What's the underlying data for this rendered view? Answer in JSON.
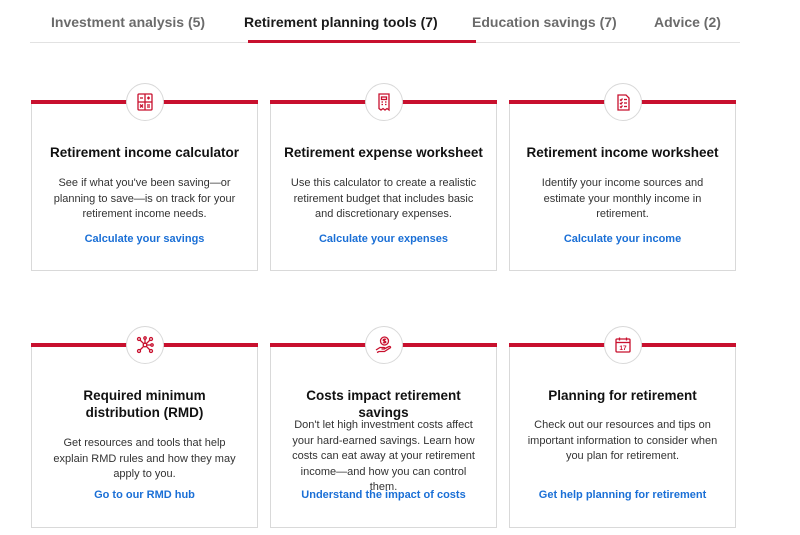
{
  "tabs": [
    {
      "label": "Investment analysis (5)",
      "active": false
    },
    {
      "label": "Retirement planning tools (7)",
      "active": true
    },
    {
      "label": "Education savings (7)",
      "active": false
    },
    {
      "label": "Advice (2)",
      "active": false
    }
  ],
  "accent_color": "#c8102e",
  "link_color": "#1a6fd6",
  "cards": [
    {
      "icon": "calculator-icon",
      "title": "Retirement income calculator",
      "description": "See if what you've been saving—or planning to save—is on track for your retirement income needs.",
      "link": "Calculate your savings"
    },
    {
      "icon": "expense-worksheet-icon",
      "title": "Retirement expense worksheet",
      "description": "Use this calculator to create a realistic retirement budget that includes basic and discretionary expenses.",
      "link": "Calculate your expenses"
    },
    {
      "icon": "checklist-icon",
      "title": "Retirement income worksheet",
      "description": "Identify your income sources and estimate your monthly income in retirement.",
      "link": "Calculate your income"
    },
    {
      "icon": "network-icon",
      "title": "Required minimum distribution (RMD)",
      "description": "Get resources and tools that help explain RMD rules and how they may apply to you.",
      "link": "Go to our RMD hub"
    },
    {
      "icon": "dollar-hand-icon",
      "title": "Costs impact retirement savings",
      "description": "Don't let high investment costs affect your hard-earned savings. Learn how costs can eat away at your retirement income—and how you can control them.",
      "link": "Understand the impact of costs"
    },
    {
      "icon": "calendar-icon",
      "calendar_day": "17",
      "title": "Planning for retirement",
      "description": "Check out our resources and tips on important information to consider when you plan for retirement.",
      "link": "Get help planning for retirement"
    }
  ]
}
